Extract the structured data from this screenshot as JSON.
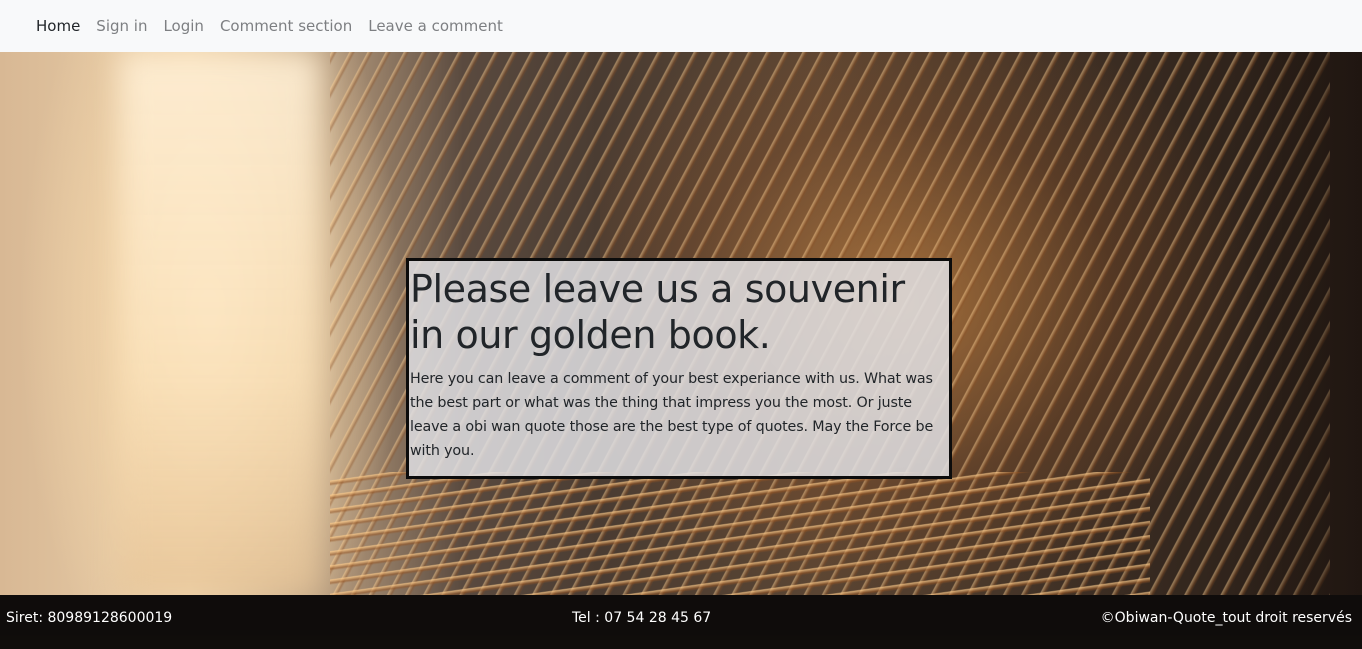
{
  "nav": {
    "items": [
      {
        "label": "Home",
        "active": true
      },
      {
        "label": "Sign in",
        "active": false
      },
      {
        "label": "Login",
        "active": false
      },
      {
        "label": "Comment section",
        "active": false
      },
      {
        "label": "Leave a comment",
        "active": false
      }
    ]
  },
  "hero": {
    "background_image": "fanned-book-pages-photo"
  },
  "card": {
    "title": "Please leave us a souvenir in our golden book.",
    "text": "Here you can leave a comment of your best experiance with us. What was the best part or what was the thing that impress you the most. Or juste leave a obi wan quote those are the best type of quotes. May the Force be with you."
  },
  "footer": {
    "siret": "Siret: 80989128600019",
    "tel": "Tel : 07 54 28 45 67",
    "copyright": "©Obiwan-Quote_tout droit reservés"
  },
  "colors": {
    "navbar_bg": "#f8f9fa",
    "nav_active": "#212529",
    "nav_inactive": "#7d7f82",
    "footer_bg": "#0c0a09",
    "card_border": "#0c0c0c"
  }
}
